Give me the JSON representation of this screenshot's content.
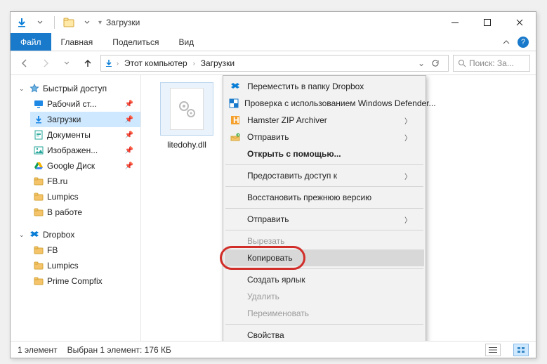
{
  "title": "Загрузки",
  "ribbon": {
    "file": "Файл",
    "tabs": [
      "Главная",
      "Поделиться",
      "Вид"
    ]
  },
  "breadcrumb": {
    "root": "Этот компьютер",
    "current": "Загрузки"
  },
  "search": {
    "placeholder": "Поиск: За..."
  },
  "tree": {
    "quick": {
      "label": "Быстрый доступ",
      "items": [
        {
          "label": "Рабочий ст...",
          "icon": "desktop",
          "color": "#1e88e5",
          "pinned": true
        },
        {
          "label": "Загрузки",
          "icon": "download",
          "color": "#1e88e5",
          "pinned": true,
          "selected": true
        },
        {
          "label": "Документы",
          "icon": "document",
          "color": "#26a69a",
          "pinned": true
        },
        {
          "label": "Изображен...",
          "icon": "image",
          "color": "#26a69a",
          "pinned": true
        },
        {
          "label": "Google Диск",
          "icon": "gdrive",
          "color": "#f4b400",
          "pinned": true
        },
        {
          "label": "FB.ru",
          "icon": "folder",
          "color": "#f5c36a"
        },
        {
          "label": "Lumpics",
          "icon": "folder",
          "color": "#f5c36a"
        },
        {
          "label": "В работе",
          "icon": "folder",
          "color": "#f5c36a"
        }
      ]
    },
    "dropbox": {
      "label": "Dropbox",
      "items": [
        {
          "label": "FB",
          "icon": "folder",
          "color": "#f5c36a"
        },
        {
          "label": "Lumpics",
          "icon": "folder",
          "color": "#f5c36a"
        },
        {
          "label": "Prime Compfix",
          "icon": "folder",
          "color": "#f5c36a"
        }
      ]
    }
  },
  "file": {
    "name": "litedohy.dll"
  },
  "context_menu": [
    {
      "label": "Переместить в папку Dropbox",
      "icon": "dropbox"
    },
    {
      "label": "Проверка с использованием Windows Defender...",
      "icon": "defender"
    },
    {
      "label": "Hamster ZIP Archiver",
      "icon": "hamster",
      "submenu": true
    },
    {
      "label": "Отправить",
      "icon": "send",
      "submenu": true
    },
    {
      "label": "Открыть с помощью...",
      "bold": true
    },
    {
      "sep": true
    },
    {
      "label": "Предоставить доступ к",
      "submenu": true
    },
    {
      "sep": true
    },
    {
      "label": "Восстановить прежнюю версию"
    },
    {
      "sep": true
    },
    {
      "label": "Отправить",
      "submenu": true
    },
    {
      "sep": true
    },
    {
      "label": "Вырезать",
      "disabled": true
    },
    {
      "label": "Копировать",
      "hover": true,
      "highlight": true
    },
    {
      "sep": true
    },
    {
      "label": "Создать ярлык"
    },
    {
      "label": "Удалить",
      "disabled": true
    },
    {
      "label": "Переименовать",
      "disabled": true
    },
    {
      "sep": true
    },
    {
      "label": "Свойства"
    }
  ],
  "status": {
    "count": "1 элемент",
    "selection": "Выбран 1 элемент: 176 КБ"
  }
}
